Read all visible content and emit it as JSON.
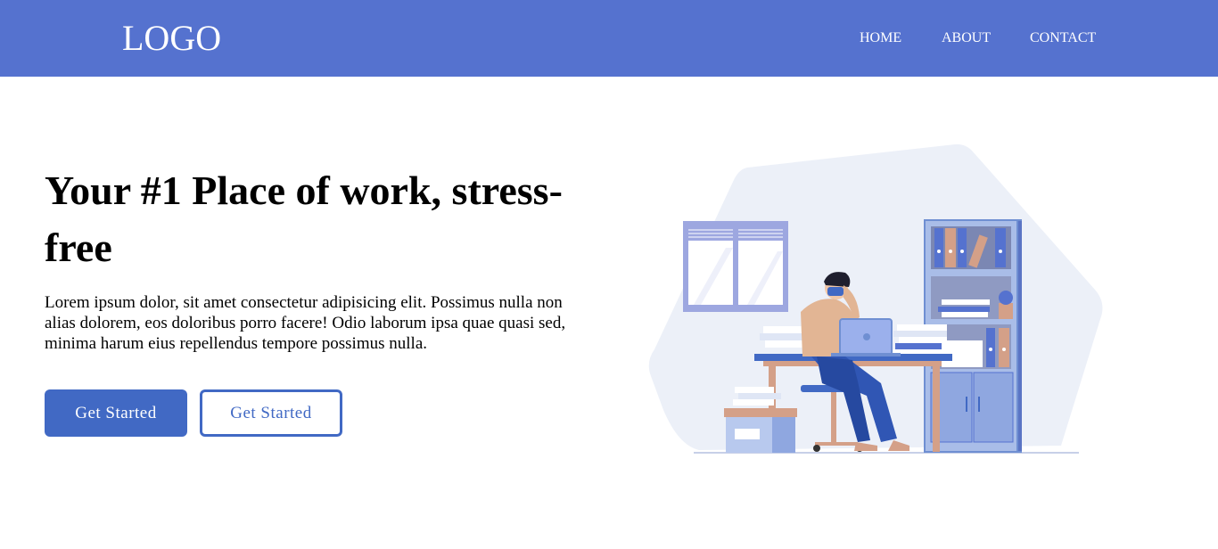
{
  "header": {
    "logo": "LOGO",
    "nav": [
      {
        "label": "HOME"
      },
      {
        "label": "ABOUT"
      },
      {
        "label": "CONTACT"
      }
    ]
  },
  "hero": {
    "title": "Your #1 Place of work, stress-free",
    "description": "Lorem ipsum dolor, sit amet consectetur adipisicing elit. Possimus nulla non alias dolorem, eos doloribus porro facere! Odio laborum ipsa quae quasi sed, minima harum eius repellendus tempore possimus nulla.",
    "primary_button": "Get Started",
    "secondary_button": "Get Started"
  },
  "colors": {
    "navbar": "#5572cf",
    "accent": "#4169c4",
    "illustration_bg": "#ecf0f8"
  }
}
